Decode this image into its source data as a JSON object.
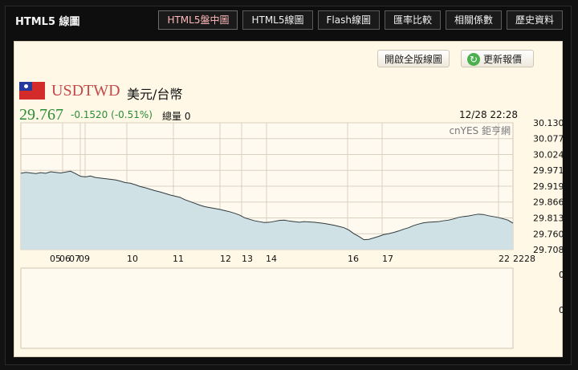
{
  "app": {
    "title": "HTML5 線圖"
  },
  "tabs": [
    {
      "label": "HTML5盤中圖",
      "active": true
    },
    {
      "label": "HTML5線圖",
      "active": false
    },
    {
      "label": "Flash線圖",
      "active": false
    },
    {
      "label": "匯率比較",
      "active": false
    },
    {
      "label": "相關係數",
      "active": false
    },
    {
      "label": "歷史資料",
      "active": false
    }
  ],
  "buttons": {
    "full_chart": "開啟全版線圖",
    "refresh": "更新報價"
  },
  "quote": {
    "symbol": "USDTWD",
    "name": "美元/台幣",
    "price": "29.767",
    "change": "-0.1520 (-0.51%)",
    "volume": "總量 0",
    "time": "12/28 22:28"
  },
  "chart_data": {
    "type": "area",
    "watermark": "cnYES 鉅亨網",
    "y_ticks": [
      "30.1300",
      "30.0773",
      "30.0245",
      "29.9718",
      "29.9190",
      "29.8663",
      "29.8135",
      "29.7607",
      "29.7080"
    ],
    "x_ticks": [
      "05",
      "06",
      "07",
      "09",
      "10",
      "11",
      "12",
      "13",
      "14",
      "16",
      "17",
      "22",
      "2228"
    ],
    "ylim": [
      29.708,
      30.13
    ],
    "grid": true,
    "colors": {
      "fill": "#cfe1e4",
      "line": "#2f3a3d",
      "grid": "#d8d0c0"
    },
    "series": [
      {
        "values": [
          29.962,
          29.965,
          29.963,
          29.961,
          29.964,
          29.962,
          29.967,
          29.965,
          29.963,
          29.966,
          29.969,
          29.961,
          29.952,
          29.95,
          29.953,
          29.948,
          29.946,
          29.944,
          29.942,
          29.94,
          29.936,
          29.931,
          29.929,
          29.924,
          29.918,
          29.914,
          29.909,
          29.904,
          29.9,
          29.895,
          29.89,
          29.886,
          29.882,
          29.874,
          29.868,
          29.862,
          29.856,
          29.851,
          29.848,
          29.845,
          29.842,
          29.838,
          29.834,
          29.829,
          29.823,
          29.814,
          29.809,
          29.804,
          29.801,
          29.798,
          29.799,
          29.802,
          29.805,
          29.806,
          29.803,
          29.801,
          29.799,
          29.801,
          29.8,
          29.799,
          29.797,
          29.795,
          29.792,
          29.789,
          29.785,
          29.781,
          29.773,
          29.761,
          29.752,
          29.741,
          29.742,
          29.747,
          29.752,
          29.758,
          29.761,
          29.765,
          29.77,
          29.776,
          29.781,
          29.788,
          29.793,
          29.797,
          29.799,
          29.8,
          29.801,
          29.804,
          29.806,
          29.81,
          29.815,
          29.818,
          29.82,
          29.823,
          29.826,
          29.825,
          29.821,
          29.818,
          29.815,
          29.811,
          29.806,
          29.796
        ]
      }
    ]
  }
}
